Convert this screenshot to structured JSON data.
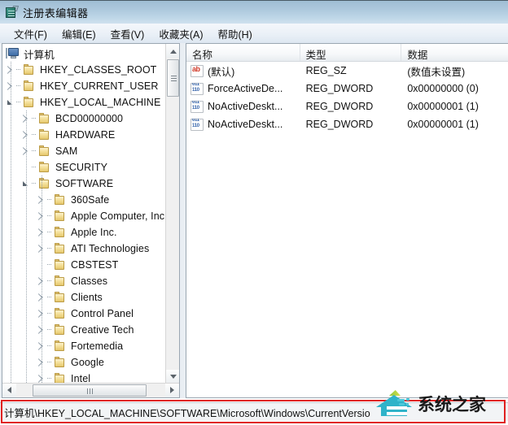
{
  "window": {
    "title": "注册表编辑器",
    "icon": "registry-editor-icon"
  },
  "menubar": {
    "items": [
      {
        "label": "文件(F)",
        "name": "menu-file"
      },
      {
        "label": "编辑(E)",
        "name": "menu-edit"
      },
      {
        "label": "查看(V)",
        "name": "menu-view"
      },
      {
        "label": "收藏夹(A)",
        "name": "menu-favorites"
      },
      {
        "label": "帮助(H)",
        "name": "menu-help"
      }
    ]
  },
  "tree": {
    "root": {
      "label": "计算机",
      "icon": "computer-icon"
    },
    "nodes": [
      {
        "label": "HKEY_CLASSES_ROOT",
        "level": 1,
        "state": "collapsed"
      },
      {
        "label": "HKEY_CURRENT_USER",
        "level": 1,
        "state": "collapsed"
      },
      {
        "label": "HKEY_LOCAL_MACHINE",
        "level": 1,
        "state": "expanded"
      },
      {
        "label": "BCD00000000",
        "level": 2,
        "state": "collapsed"
      },
      {
        "label": "HARDWARE",
        "level": 2,
        "state": "collapsed"
      },
      {
        "label": "SAM",
        "level": 2,
        "state": "collapsed"
      },
      {
        "label": "SECURITY",
        "level": 2,
        "state": "leaf"
      },
      {
        "label": "SOFTWARE",
        "level": 2,
        "state": "expanded"
      },
      {
        "label": "360Safe",
        "level": 3,
        "state": "collapsed"
      },
      {
        "label": "Apple Computer, Inc",
        "level": 3,
        "state": "collapsed"
      },
      {
        "label": "Apple Inc.",
        "level": 3,
        "state": "collapsed"
      },
      {
        "label": "ATI Technologies",
        "level": 3,
        "state": "collapsed"
      },
      {
        "label": "CBSTEST",
        "level": 3,
        "state": "leaf"
      },
      {
        "label": "Classes",
        "level": 3,
        "state": "collapsed"
      },
      {
        "label": "Clients",
        "level": 3,
        "state": "collapsed"
      },
      {
        "label": "Control Panel",
        "level": 3,
        "state": "collapsed"
      },
      {
        "label": "Creative Tech",
        "level": 3,
        "state": "collapsed"
      },
      {
        "label": "Fortemedia",
        "level": 3,
        "state": "collapsed"
      },
      {
        "label": "Google",
        "level": 3,
        "state": "collapsed"
      },
      {
        "label": "Intel",
        "level": 3,
        "state": "collapsed"
      }
    ]
  },
  "list": {
    "columns": [
      {
        "label": "名称",
        "name": "column-name"
      },
      {
        "label": "类型",
        "name": "column-type"
      },
      {
        "label": "数据",
        "name": "column-data"
      }
    ],
    "rows": [
      {
        "icon": "string-value-icon",
        "name": "(默认)",
        "type": "REG_SZ",
        "data": "(数值未设置)"
      },
      {
        "icon": "dword-value-icon",
        "name": "ForceActiveDe...",
        "type": "REG_DWORD",
        "data": "0x00000000 (0)"
      },
      {
        "icon": "dword-value-icon",
        "name": "NoActiveDeskt...",
        "type": "REG_DWORD",
        "data": "0x00000001 (1)"
      },
      {
        "icon": "dword-value-icon",
        "name": "NoActiveDeskt...",
        "type": "REG_DWORD",
        "data": "0x00000001 (1)"
      }
    ]
  },
  "statusbar": {
    "path": "计算机\\HKEY_LOCAL_MACHINE\\SOFTWARE\\Microsoft\\Windows\\CurrentVersio"
  },
  "watermark": {
    "text": "系统之家"
  },
  "colors": {
    "titlebar_top": "#9fbdd4",
    "titlebar_bottom": "#cfe1ee",
    "annotation_red": "#e02020",
    "watermark_cyan": "#2fb3c9",
    "folder_yellow": "#f4e09a"
  }
}
